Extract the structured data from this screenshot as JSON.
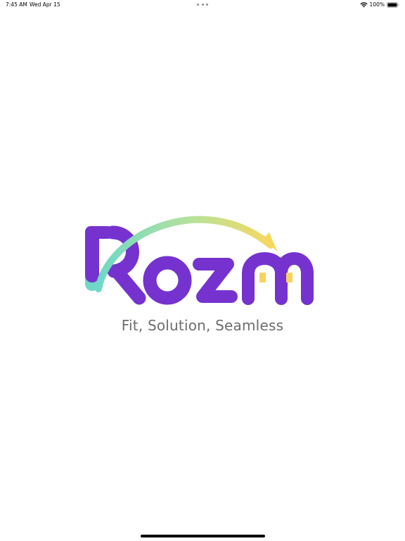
{
  "status_bar": {
    "time": "7:45 AM",
    "date": "Wed Apr 15",
    "battery": "100%"
  },
  "logo": {
    "wordmark": "Rozm",
    "colors": {
      "primary": "#7532cf",
      "arc_start": "#6fd8c6",
      "arc_end": "#f6d860",
      "window": "#f6d35f"
    }
  },
  "tagline": "Fit, Solution, Seamless",
  "icons": {
    "wifi": "wifi-icon",
    "battery": "battery-icon",
    "multitask": "multitask-dots-icon"
  }
}
